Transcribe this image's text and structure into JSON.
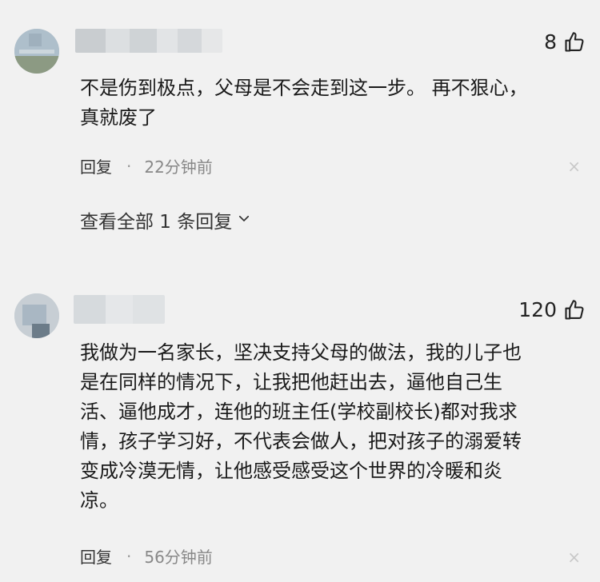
{
  "comments": [
    {
      "likes": "8",
      "text": "不是伤到极点，父母是不会走到这一步。 再不狠心，\n真就废了",
      "reply_label": "回复",
      "separator": "·",
      "time": "22分钟前",
      "close_glyph": "×",
      "view_replies": "查看全部 1 条回复",
      "view_replies_chevron": "chevron-down-icon"
    },
    {
      "likes": "120",
      "text": "我做为一名家长，坚决支持父母的做法，我的儿子也\n是在同样的情况下，让我把他赶出去，逼他自己生\n活、逼他成才，连他的班主任(学校副校长)都对我求\n情，孩子学习好，不代表会做人，把对孩子的溺爱转\n变成冷漠无情，让他感受感受这个世界的冷暖和炎\n凉。",
      "reply_label": "回复",
      "separator": "·",
      "time": "56分钟前",
      "close_glyph": "×"
    }
  ],
  "icons": {
    "like": "thumbs-up-icon",
    "avatar": "avatar",
    "close": "close-icon"
  },
  "colors": {
    "background": "#f1f1f1",
    "text": "#1a1a1a",
    "muted": "#888888"
  }
}
